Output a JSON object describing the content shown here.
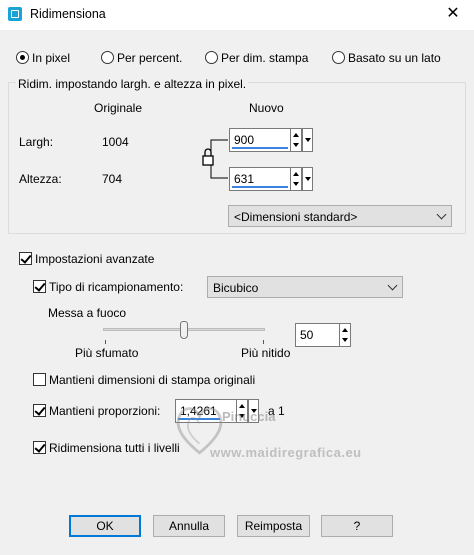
{
  "window": {
    "title": "Ridimensiona",
    "close_glyph": "✕"
  },
  "mode_options": [
    {
      "label": "In pixel",
      "selected": true
    },
    {
      "label": "Per percent.",
      "selected": false
    },
    {
      "label": "Per dim. stampa",
      "selected": false
    },
    {
      "label": "Basato su un lato",
      "selected": false
    }
  ],
  "pixel_group": {
    "legend": "Ridim. impostando largh. e altezza in pixel.",
    "original_header": "Originale",
    "new_header": "Nuovo",
    "width_label": "Largh:",
    "height_label": "Altezza:",
    "original_width": "1004",
    "original_height": "704",
    "new_width": "900",
    "new_height": "631",
    "standard_sizes": "<Dimensioni standard>",
    "lock_icon": "lock-icon"
  },
  "advanced": {
    "label": "Impostazioni avanzate",
    "checked": true,
    "resample_label": "Tipo di ricampionamento:",
    "resample_checked": true,
    "resample_value": "Bicubico",
    "sharpen_label": "Messa a fuoco",
    "sharpen_min_label": "Più sfumato",
    "sharpen_max_label": "Più nitido",
    "sharpen_value": "50",
    "keep_print_label": "Mantieni dimensioni di stampa originali",
    "keep_print_checked": false,
    "keep_ratio_label": "Mantieni proporzioni:",
    "keep_ratio_checked": true,
    "ratio_value": "1,4261",
    "ratio_suffix": "a 1",
    "resize_layers_label": "Ridimensiona tutti i livelli",
    "resize_layers_checked": true
  },
  "buttons": {
    "ok": "OK",
    "cancel": "Annulla",
    "reset": "Reimposta",
    "help": "?"
  },
  "watermark": {
    "line1": "Pinuccia",
    "line2": "www.maidiregrafica.eu"
  },
  "colors": {
    "accent": "#0078d7",
    "value_underline": "#3a84e0"
  }
}
